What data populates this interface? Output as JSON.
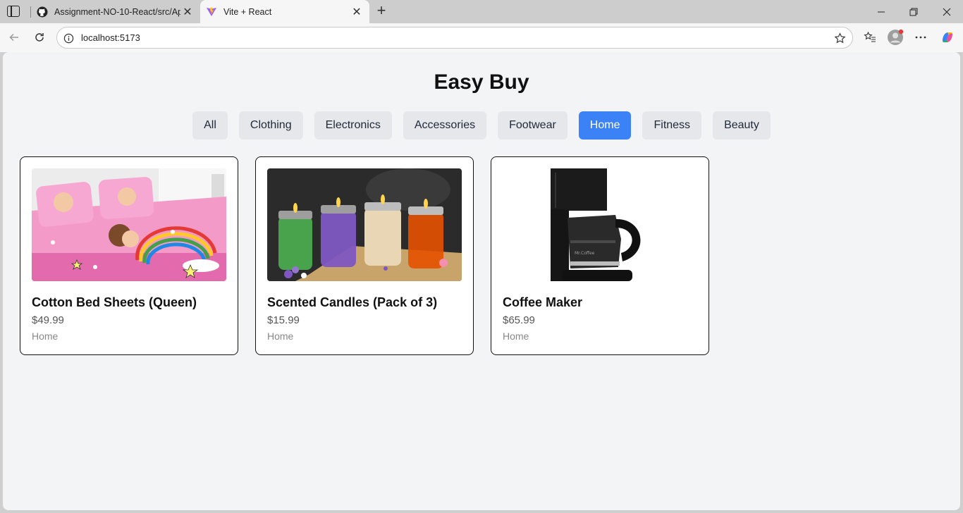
{
  "browser": {
    "tabs": [
      {
        "title": "Assignment-NO-10-React/src/App",
        "favicon": "github-icon",
        "active": false
      },
      {
        "title": "Vite + React",
        "favicon": "vite-icon",
        "active": true
      }
    ],
    "address": "localhost:5173"
  },
  "page": {
    "title": "Easy Buy",
    "filters": [
      "All",
      "Clothing",
      "Electronics",
      "Accessories",
      "Footwear",
      "Home",
      "Fitness",
      "Beauty"
    ],
    "active_filter": "Home",
    "products": [
      {
        "name": "Cotton Bed Sheets (Queen)",
        "price": "$49.99",
        "category": "Home"
      },
      {
        "name": "Scented Candles (Pack of 3)",
        "price": "$15.99",
        "category": "Home"
      },
      {
        "name": "Coffee Maker",
        "price": "$65.99",
        "category": "Home"
      }
    ]
  },
  "colors": {
    "accent": "#3b82f6",
    "filter_bg": "#e5e7eb",
    "page_bg": "#f3f4f6"
  }
}
